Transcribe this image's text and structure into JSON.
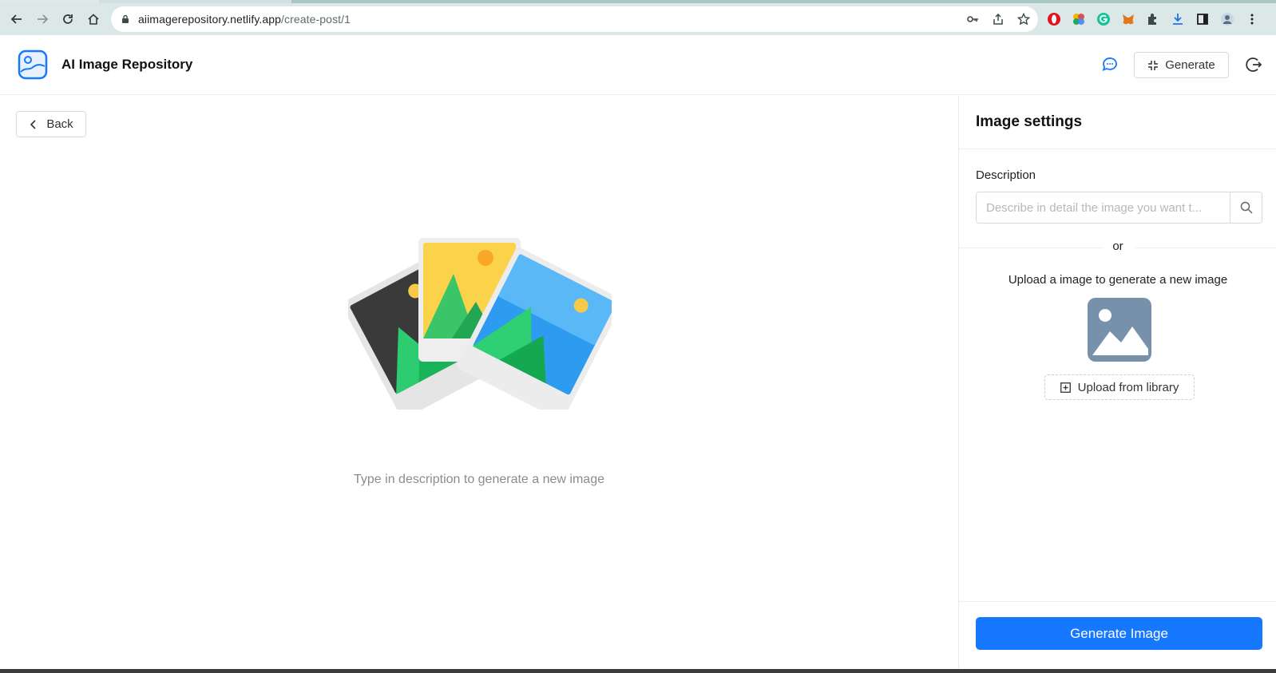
{
  "browser": {
    "url_host": "aiimagerepository.netlify.app",
    "url_path": "/create-post/1",
    "extensions": [
      "opera-icon",
      "color-wheel-icon",
      "grammarly-icon",
      "metamask-icon",
      "puzzle-icon",
      "download-icon",
      "sidebar-icon",
      "profile-avatar-icon",
      "more-icon"
    ]
  },
  "header": {
    "app_name": "AI Image Repository",
    "generate_label": "Generate"
  },
  "main": {
    "back_label": "Back",
    "empty_message": "Type in description to generate a new image"
  },
  "panel": {
    "title": "Image settings",
    "description_label": "Description",
    "description_placeholder": "Describe in detail the image you want t...",
    "or_text": "or",
    "upload_text": "Upload a image to generate a new image",
    "upload_button_label": "Upload from library",
    "generate_image_label": "Generate Image"
  },
  "colors": {
    "accent": "#1677ff",
    "chrome_toolbar": "#dce8e7"
  }
}
